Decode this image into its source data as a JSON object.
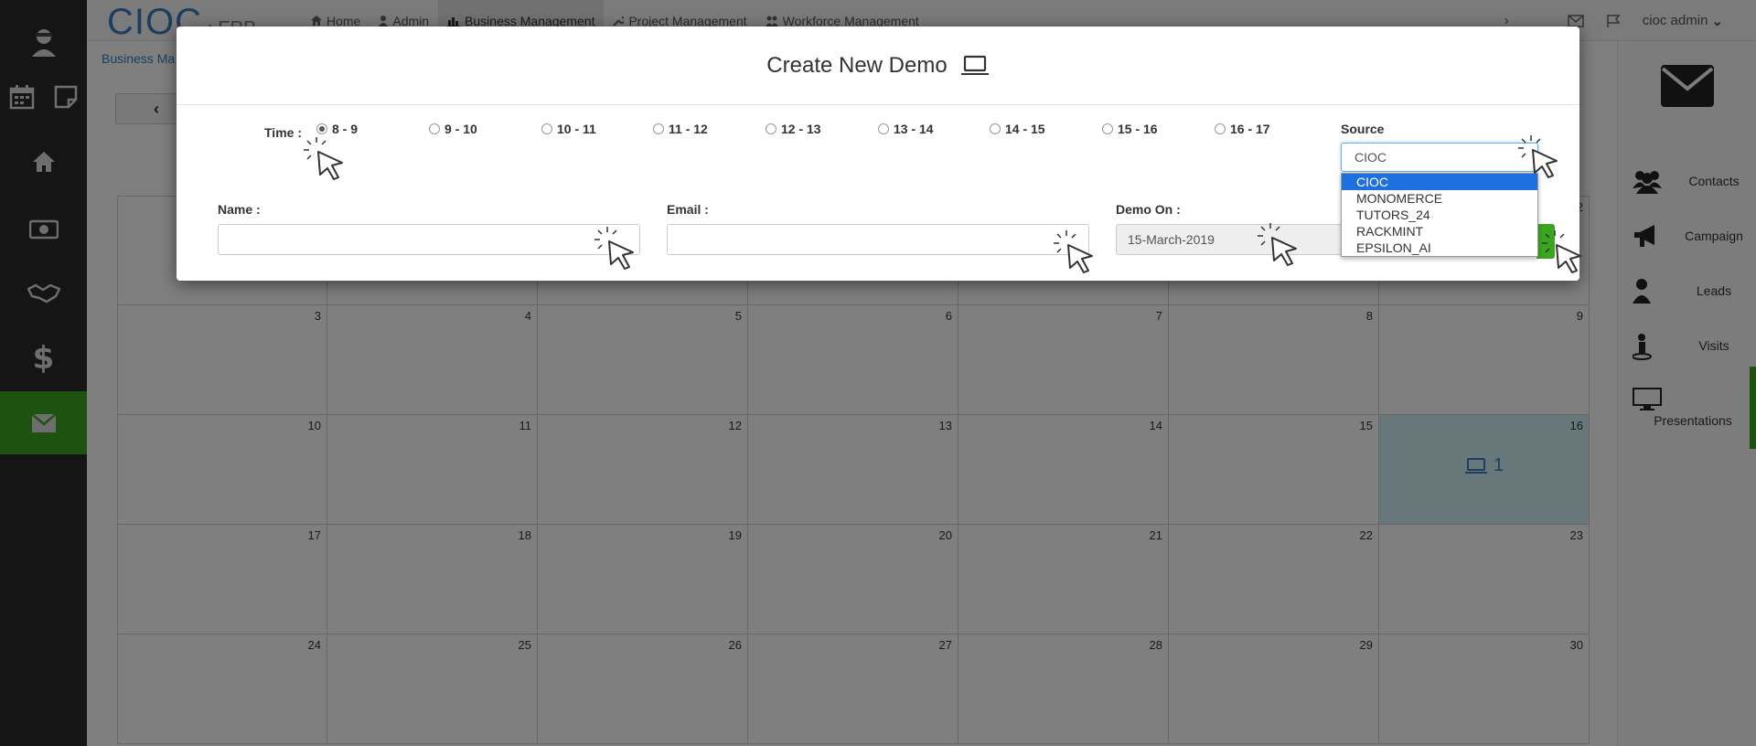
{
  "app": {
    "brand": "CIOC",
    "module": "ERP"
  },
  "nav": {
    "items": [
      {
        "label": "Home",
        "icon": "home-icon"
      },
      {
        "label": "Admin",
        "icon": "user-icon"
      },
      {
        "label": "Business Management",
        "icon": "bar-chart-icon"
      },
      {
        "label": "Project Management",
        "icon": "wrench-icon"
      },
      {
        "label": "Workforce Management",
        "icon": "users-icon"
      }
    ],
    "user": "cioc admin"
  },
  "breadcrumb": "Business Ma",
  "left_sidebar": {
    "items": [
      "avatar-icon",
      "calendar-icon",
      "note-icon",
      "home-icon",
      "money-icon",
      "handshake-icon",
      "dollar-icon",
      "mail-icon"
    ],
    "active": "mail-icon",
    "accent": "#3aa61f"
  },
  "calendar": {
    "rows": [
      [
        {
          "day": ""
        },
        {
          "day": ""
        },
        {
          "day": ""
        },
        {
          "day": ""
        },
        {
          "day": ""
        },
        {
          "day": ""
        },
        {
          "day": "2"
        }
      ],
      [
        {
          "day": "3"
        },
        {
          "day": "4"
        },
        {
          "day": "5"
        },
        {
          "day": "6"
        },
        {
          "day": "7"
        },
        {
          "day": "8"
        },
        {
          "day": "9"
        }
      ],
      [
        {
          "day": "10"
        },
        {
          "day": "11"
        },
        {
          "day": "12"
        },
        {
          "day": "13"
        },
        {
          "day": "14"
        },
        {
          "day": "15"
        },
        {
          "day": "16",
          "event_count": "1"
        }
      ],
      [
        {
          "day": "17"
        },
        {
          "day": "18"
        },
        {
          "day": "19"
        },
        {
          "day": "20"
        },
        {
          "day": "21"
        },
        {
          "day": "22"
        },
        {
          "day": "23"
        }
      ],
      [
        {
          "day": "24"
        },
        {
          "day": "25"
        },
        {
          "day": "26"
        },
        {
          "day": "27"
        },
        {
          "day": "28"
        },
        {
          "day": "29"
        },
        {
          "day": "30"
        }
      ]
    ]
  },
  "right_sidebar": {
    "items": [
      {
        "label": "Contacts",
        "icon": "users-icon"
      },
      {
        "label": "Campaign",
        "icon": "bullhorn-icon"
      },
      {
        "label": "Leads",
        "icon": "user-icon"
      },
      {
        "label": "Visits",
        "icon": "visit-icon"
      },
      {
        "label": "Presentations",
        "icon": "monitor-icon"
      }
    ]
  },
  "modal": {
    "title": "Create New Demo",
    "time_label": "Time :",
    "time_slots": [
      "8 - 9",
      "9 - 10",
      "10 - 11",
      "11 - 12",
      "12 - 13",
      "13 - 14",
      "14 - 15",
      "15 - 16",
      "16 - 17"
    ],
    "selected_slot": "8 - 9",
    "name_label": "Name :",
    "name_value": "",
    "email_label": "Email :",
    "email_value": "",
    "demo_on_label": "Demo On :",
    "demo_on_value": "15-March-2019",
    "source_label": "Source",
    "source_value": "CIOC",
    "source_options": [
      "CIOC",
      "MONOMERCE",
      "TUTORS_24",
      "RACKMINT",
      "EPSILON_AI"
    ]
  }
}
